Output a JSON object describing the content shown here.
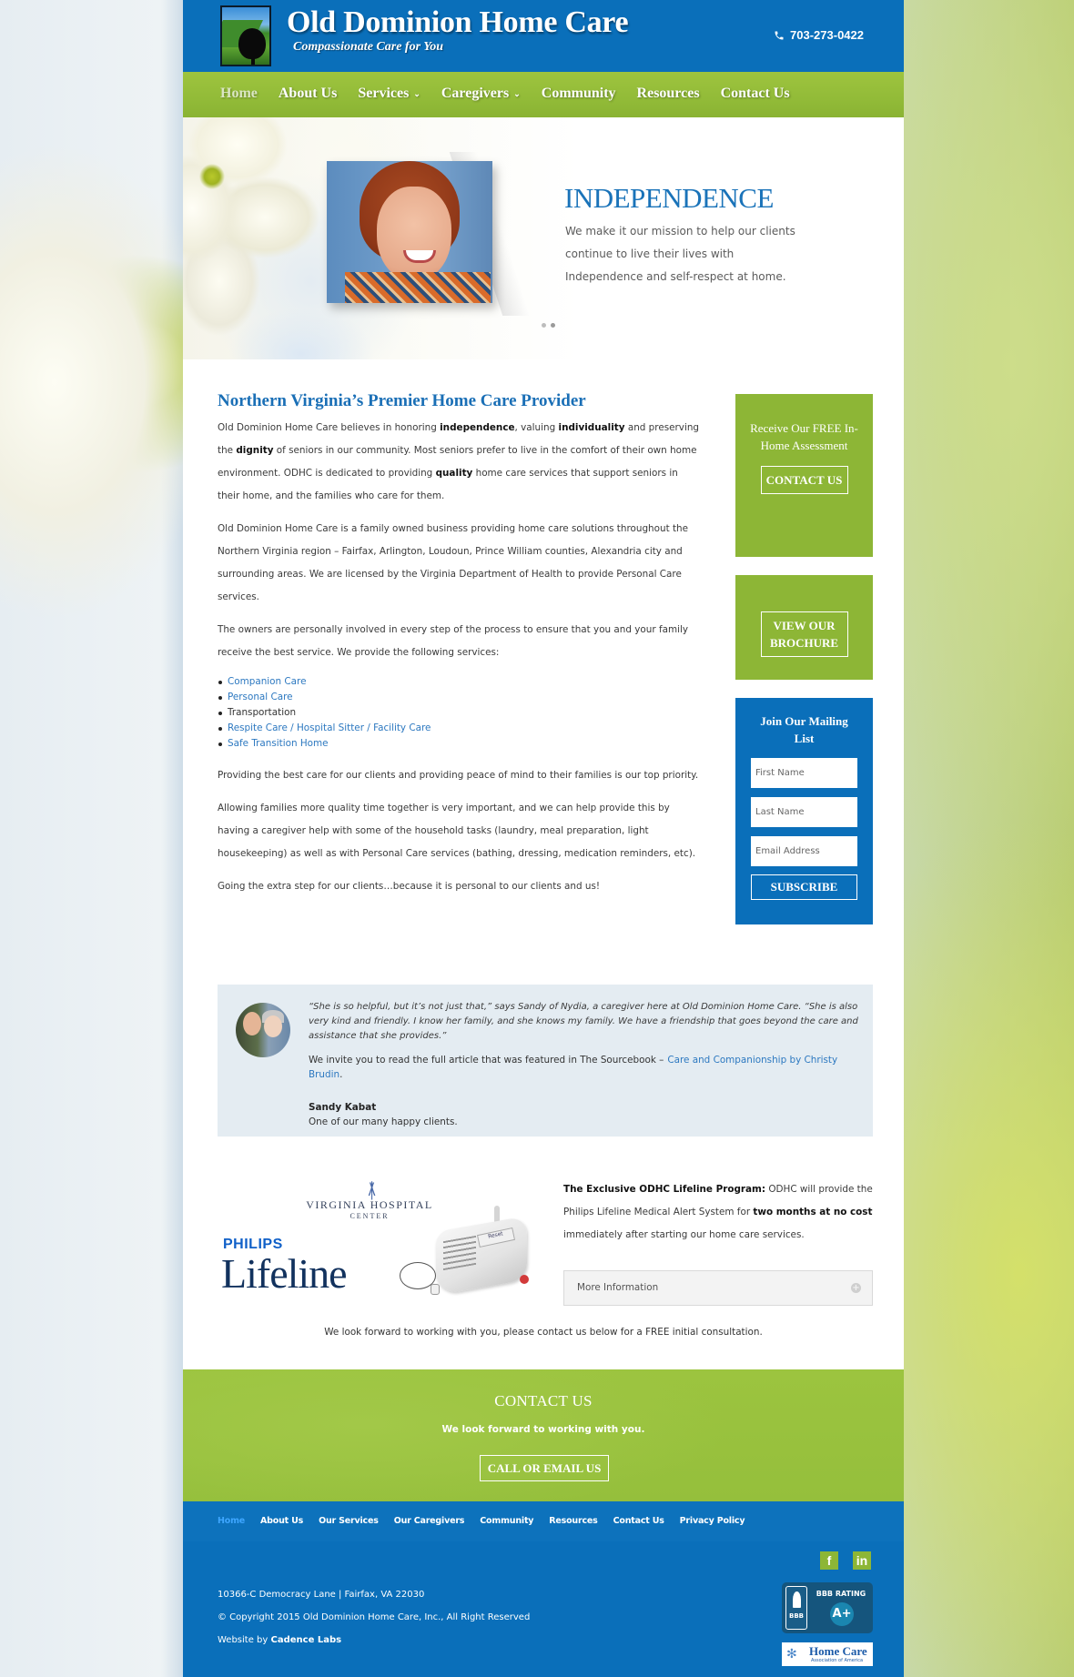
{
  "header": {
    "site_title": "Old Dominion Home Care",
    "tagline": "Compassionate Care for You",
    "phone": "703-273-0422",
    "phone_icon": "phone-icon"
  },
  "nav": {
    "items": [
      {
        "label": "Home",
        "active": true,
        "dropdown": false
      },
      {
        "label": "About Us",
        "active": false,
        "dropdown": false
      },
      {
        "label": "Services",
        "active": false,
        "dropdown": true
      },
      {
        "label": "Caregivers",
        "active": false,
        "dropdown": true
      },
      {
        "label": "Community",
        "active": false,
        "dropdown": false
      },
      {
        "label": "Resources",
        "active": false,
        "dropdown": false
      },
      {
        "label": "Contact Us",
        "active": false,
        "dropdown": false
      }
    ],
    "caret": "⌄"
  },
  "hero": {
    "title": "INDEPENDENCE",
    "text": "We make it our mission to help our clients continue to live their lives with Independence and self-respect at home.",
    "slides": 2,
    "active_slide": 2
  },
  "main": {
    "heading": "Northern Virginia’s Premier Home Care Provider",
    "p1": [
      {
        "t": "Old Dominion Home Care believes in honoring "
      },
      {
        "b": "independence"
      },
      {
        "t": ", valuing "
      },
      {
        "b": "individuality"
      },
      {
        "t": " and preserving the "
      },
      {
        "b": "dignity"
      },
      {
        "t": " of seniors in our community. Most seniors prefer to live in the comfort of their own home environment. ODHC is dedicated to providing "
      },
      {
        "b": "quality"
      },
      {
        "t": " home care services that support seniors in their home, and the families who care for them."
      }
    ],
    "p2": "Old Dominion Home Care is a family owned business providing home care solutions throughout the Northern Virginia region – Fairfax, Arlington, Loudoun, Prince William counties, Alexandria city and surrounding areas. We are licensed by the Virginia Department of Health to provide Personal Care services.",
    "p3": "The owners are personally involved in every step of the process to ensure that you and your family receive the best service. We provide the following services:",
    "services": [
      {
        "label": "Companion Care",
        "link": true
      },
      {
        "label": "Personal Care",
        "link": true
      },
      {
        "label": "Transportation",
        "link": false
      },
      {
        "label": "Respite Care / Hospital Sitter / Facility Care",
        "link": true
      },
      {
        "label": "Safe Transition Home",
        "link": true
      }
    ],
    "p4": "Providing the best care for our clients and providing peace of mind to their families is our top priority.",
    "p5": "Allowing families more quality time together is very important, and we can help provide this by having a caregiver help with some of the household tasks (laundry, meal preparation, light housekeeping) as well as with Personal Care services (bathing, dressing, medication reminders, etc).",
    "p6": "Going the extra step for our clients…because it is personal to our clients and us!"
  },
  "sidebar": {
    "assessment_title": "Receive Our FREE In-Home Assessment",
    "contact_button": "CONTACT US",
    "brochure_button": "VIEW OUR BROCHURE",
    "mailing_title": "Join Our Mailing List",
    "first_name_placeholder": "First Name",
    "last_name_placeholder": "Last Name",
    "email_placeholder": "Email Address",
    "subscribe_button": "SUBSCRIBE"
  },
  "testimonial": {
    "quote": "“She is so helpful, but it’s not just that,” says Sandy of Nydia, a caregiver here at Old Dominion Home Care. “She is also very kind and friendly. I know her family, and she knows my family. We have a friendship that goes beyond the care and assistance that she provides.”",
    "invite_text": "We invite you to read the full article that was featured in The Sourcebook –",
    "article_link": "Care and Companionship by Christy Brudin",
    "name": "Sandy Kabat",
    "role": "One of our many happy clients."
  },
  "lifeline": {
    "vh_line1": "VIRGINIA HOSPITAL",
    "vh_line2": "CENTER",
    "philips": "PHILIPS",
    "lifeline_word": "Lifeline",
    "device_label": "Reset",
    "program_label": "The Exclusive ODHC Lifeline Program:",
    "text_a": " ODHC will provide the Philips Lifeline Medical Alert System for ",
    "text_bold": "two months at no cost",
    "text_b": " immediately after starting our home care services.",
    "more_info": "More Information",
    "more_info_icon": "plus-circle-icon"
  },
  "consult_text": "We look forward to working with you, please contact us below for a FREE initial consultation.",
  "contact_band": {
    "title": "CONTACT US",
    "subtitle": "We look forward to working with you.",
    "button": "CALL OR EMAIL US"
  },
  "footer_nav": {
    "items": [
      {
        "label": "Home",
        "active": true
      },
      {
        "label": "About Us",
        "active": false
      },
      {
        "label": "Our Services",
        "active": false
      },
      {
        "label": "Our Caregivers",
        "active": false
      },
      {
        "label": "Community",
        "active": false
      },
      {
        "label": "Resources",
        "active": false
      },
      {
        "label": "Contact Us",
        "active": false
      },
      {
        "label": "Privacy Policy",
        "active": false
      }
    ]
  },
  "footer": {
    "address": "10366-C Democracy Lane | Fairfax, VA 22030",
    "copyright": "© Copyright 2015 Old Dominion Home Care, Inc., All Right Reserved",
    "website_by": "Website by ",
    "website_by_name": "Cadence Labs",
    "social": [
      {
        "icon": "facebook-icon",
        "glyph": "f"
      },
      {
        "icon": "linkedin-icon",
        "glyph": "in"
      }
    ],
    "bbb_seal": "BBB",
    "bbb_rating_label": "BBB RATING",
    "bbb_grade": "A+",
    "hcaa_title": "Home Care",
    "hcaa_sub": "Association of America"
  },
  "colors": {
    "brand_blue": "#0a6fba",
    "brand_green": "#8db636",
    "link_blue": "#2c78c0",
    "heading_blue": "#1a6fb6"
  }
}
